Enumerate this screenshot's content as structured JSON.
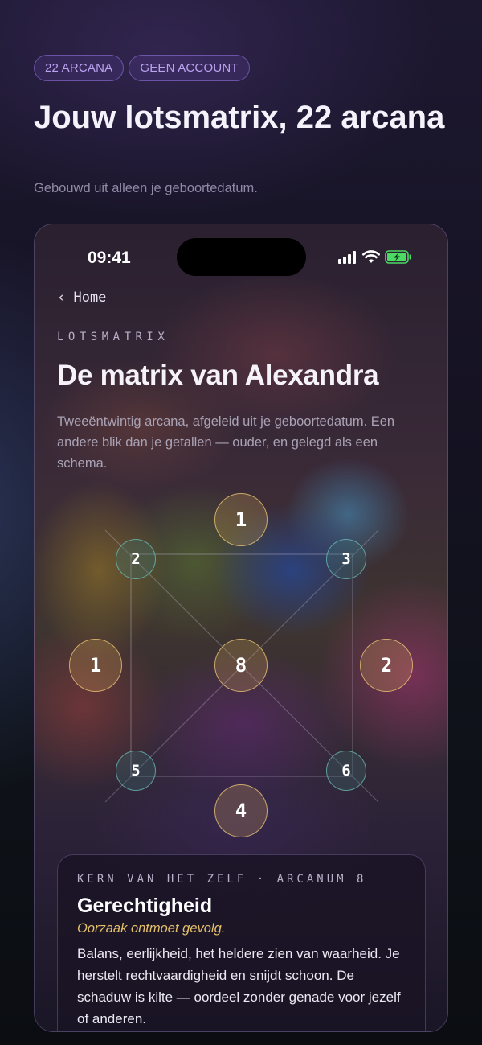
{
  "header": {
    "chips": [
      "22 ARCANA",
      "GEEN ACCOUNT"
    ],
    "title": "Jouw lotsmatrix, 22 arcana",
    "subtitle": "Gebouwd uit alleen je geboortedatum."
  },
  "phone": {
    "status_time": "09:41",
    "back_label": "‹  Home",
    "eyebrow": "LOTSMATRIX",
    "title": "De matrix van Alexandra",
    "description": "Tweeëntwintig arcana, afgeleid uit je geboortedatum. Een andere blik dan je getallen — ouder, en gelegd als een schema.",
    "matrix": {
      "top": "1",
      "top_left": "2",
      "top_right": "3",
      "left": "1",
      "center": "8",
      "right": "2",
      "bottom_left": "5",
      "bottom_right": "6",
      "bottom": "4"
    },
    "card": {
      "eyebrow": "KERN VAN HET ZELF · ARCANUM 8",
      "title": "Gerechtigheid",
      "tagline": "Oorzaak ontmoet gevolg.",
      "body": "Balans, eerlijkheid, het heldere zien van waarheid. Je herstelt rechtvaardigheid en snijdt schoon. De schaduw is kilte — oordeel zonder genade voor jezelf of anderen."
    }
  },
  "colors": {
    "accent_gold": "#e4bf6a",
    "accent_teal": "#6ec8be",
    "chip_purple": "#b9a3f0"
  }
}
